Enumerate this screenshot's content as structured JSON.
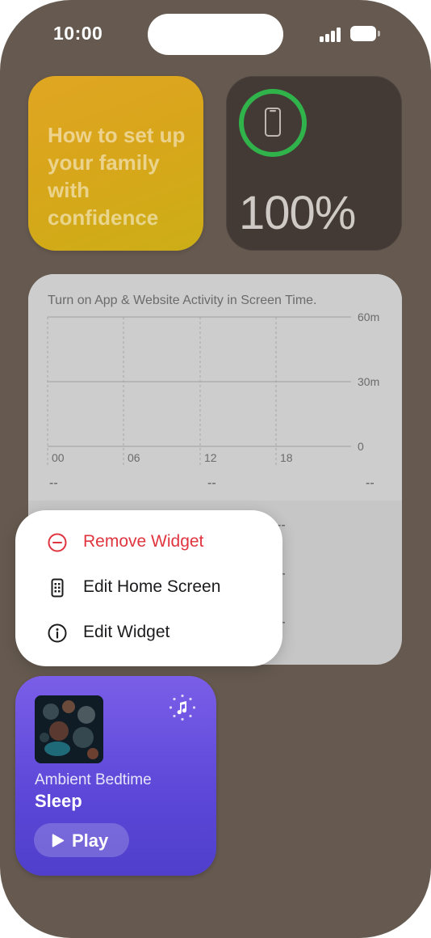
{
  "status": {
    "time": "10:00"
  },
  "tips_widget": {
    "text": "How to set up your family with confidence"
  },
  "battery_widget": {
    "percent": "100%",
    "level": 1.0,
    "ring_color": "#2fb34a"
  },
  "screen_time_widget": {
    "hint": "Turn on App & Website Activity in Screen Time.",
    "y_ticks": [
      "60m",
      "30m",
      "0"
    ],
    "x_ticks": [
      "00",
      "06",
      "12",
      "18"
    ],
    "summary": [
      "--",
      "--",
      "--"
    ],
    "lower_dashes": [
      "--",
      "--",
      "--"
    ]
  },
  "context_menu": {
    "items": [
      {
        "label": "Remove Widget",
        "icon": "minus-circle-icon",
        "color": "#e0343e"
      },
      {
        "label": "Edit Home Screen",
        "icon": "phone-apps-icon"
      },
      {
        "label": "Edit Widget",
        "icon": "info-circle-icon"
      }
    ]
  },
  "music_widget": {
    "subtitle": "Ambient Bedtime",
    "title": "Sleep",
    "play_label": "Play",
    "badge_icon": "apple-music-icon"
  }
}
